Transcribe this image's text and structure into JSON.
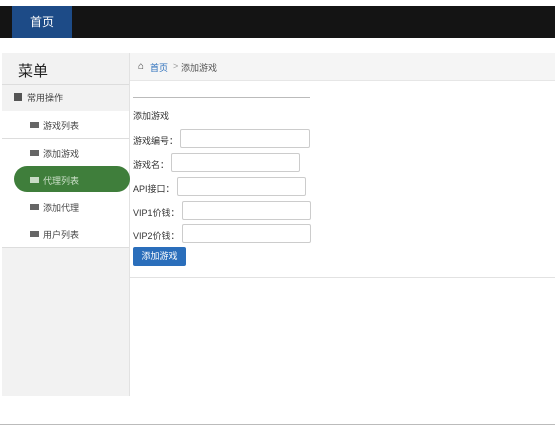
{
  "header": {
    "home_tab": "首页"
  },
  "sidebar": {
    "title": "菜单",
    "group": {
      "label": "常用操作",
      "icon": "folder-icon"
    },
    "items": [
      {
        "label": "游戏列表",
        "icon": "book-icon"
      },
      {
        "label": "添加游戏",
        "icon": "book-icon"
      },
      {
        "label": "代理列表",
        "icon": "book-icon"
      },
      {
        "label": "添加代理",
        "icon": "book-icon"
      },
      {
        "label": "用户列表",
        "icon": "book-icon"
      }
    ],
    "active_index": 2
  },
  "breadcrumb": {
    "home": "首页",
    "separator": ">",
    "current": "添加游戏"
  },
  "form": {
    "title": "添加游戏",
    "fields": [
      {
        "label": "游戏编号：",
        "value": ""
      },
      {
        "label": "游戏名：",
        "value": ""
      },
      {
        "label": "API接口：",
        "value": ""
      },
      {
        "label": "VIP1价钱：",
        "value": ""
      },
      {
        "label": "VIP2价钱：",
        "value": ""
      }
    ],
    "submit_label": "添加游戏"
  },
  "colors": {
    "topbar": "#141414",
    "tab_active": "#1d4b87",
    "nav_active": "#3f7e3b",
    "button": "#2a6ebb"
  }
}
